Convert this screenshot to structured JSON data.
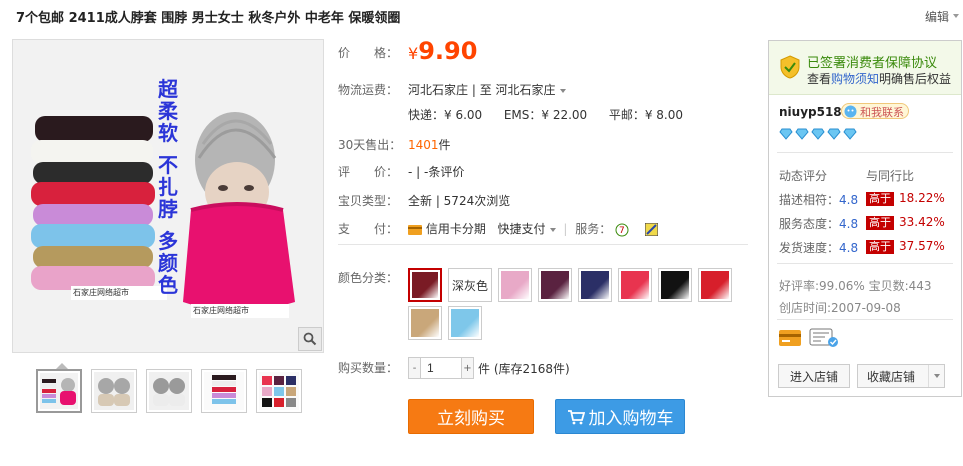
{
  "header": {
    "title": "7个包邮 2411成人脖套 围脖 男士女士 秋冬户外 中老年 保暖领圈",
    "edit_label": "编辑"
  },
  "gallery": {
    "overlay_text": [
      "超",
      "柔",
      "软",
      "不",
      "扎",
      "脖",
      "多",
      "颜",
      "色"
    ],
    "label_text": "石家庄网络超市"
  },
  "price": {
    "label": "价　　格：",
    "symbol": "¥",
    "value": "9.90"
  },
  "shipping": {
    "label": "物流运费：",
    "from": "河北石家庄",
    "to_prefix": "| 至",
    "to": "河北石家庄",
    "express": "快递：¥ 6.00",
    "ems": "EMS：¥ 22.00",
    "post": "平邮：¥ 8.00"
  },
  "sold": {
    "label": "30天售出：",
    "count": "1401",
    "unit": "件"
  },
  "rating": {
    "label": "评　　价：",
    "value": "- | -条评价"
  },
  "item_type": {
    "label": "宝贝类型：",
    "value": "全新 | 5724次浏览"
  },
  "payment": {
    "label": "支　　付：",
    "installment": "信用卡分期",
    "quick_pay": "快捷支付",
    "service_label": "服务："
  },
  "colors": {
    "label": "颜色分类：",
    "text_option": "深灰色",
    "swatches": [
      "#7a1b25",
      "#e8a9c7",
      "#5a2240",
      "#2b2f66",
      "#e8344f",
      "#121212",
      "#d71f2b",
      "#c9a77a",
      "#7ec7ea"
    ],
    "selected_swatch": "#7a1b25"
  },
  "quantity": {
    "label": "购买数量：",
    "value": "1",
    "stock": "件 (库存2168件)"
  },
  "actions": {
    "buy_now": "立刻购买",
    "add_cart": "加入购物车"
  },
  "shop": {
    "protect_title": "已签署消费者保障协议",
    "protect_sub_pre": "查看",
    "protect_link": "购物须知",
    "protect_sub_post": "明确售后权益",
    "seller": "niuyp518",
    "contact": "和我联系",
    "diamond_count": 5,
    "dsr_title": "动态评分",
    "dsr_compare": "与同行比",
    "dsr": [
      {
        "label": "描述相符：",
        "score": "4.8",
        "tag": "高于",
        "pct": "18.22%"
      },
      {
        "label": "服务态度：",
        "score": "4.8",
        "tag": "高于",
        "pct": "33.42%"
      },
      {
        "label": "发货速度：",
        "score": "4.8",
        "tag": "高于",
        "pct": "37.57%"
      }
    ],
    "good_rate": "好评率:99.06% 宝贝数:443",
    "created": "创店时间:2007-09-08",
    "enter": "进入店铺",
    "favorite": "收藏店铺"
  },
  "colors_meta": {
    "price": "#ff4400",
    "buy": "#f67a13",
    "cart": "#3d9be5",
    "higher": "#c40000"
  }
}
